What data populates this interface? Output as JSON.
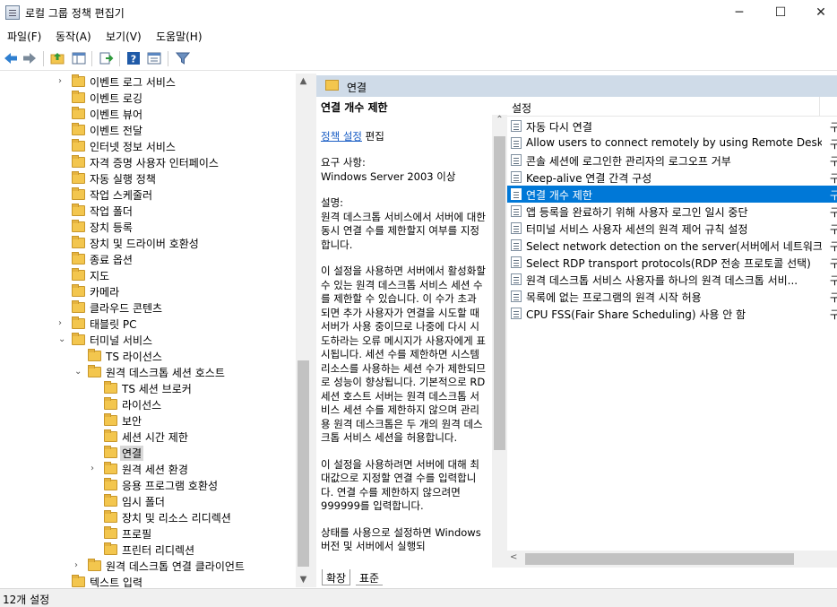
{
  "window": {
    "title": "로컬 그룹 정책 편집기",
    "minimize": "─",
    "maximize": "☐",
    "close": "✕"
  },
  "menu": [
    "파일(F)",
    "동작(A)",
    "보기(V)",
    "도움말(H)"
  ],
  "tree": [
    {
      "label": "이벤트 로그 서비스",
      "level": 0,
      "exp": "›"
    },
    {
      "label": "이벤트 로깅",
      "level": 0,
      "exp": ""
    },
    {
      "label": "이벤트 뷰어",
      "level": 0,
      "exp": ""
    },
    {
      "label": "이벤트 전달",
      "level": 0,
      "exp": ""
    },
    {
      "label": "인터넷 정보 서비스",
      "level": 0,
      "exp": ""
    },
    {
      "label": "자격 증명 사용자 인터페이스",
      "level": 0,
      "exp": ""
    },
    {
      "label": "자동 실행 정책",
      "level": 0,
      "exp": ""
    },
    {
      "label": "작업 스케줄러",
      "level": 0,
      "exp": ""
    },
    {
      "label": "작업 폴더",
      "level": 0,
      "exp": ""
    },
    {
      "label": "장치 등록",
      "level": 0,
      "exp": ""
    },
    {
      "label": "장치 및 드라이버 호환성",
      "level": 0,
      "exp": ""
    },
    {
      "label": "종료 옵션",
      "level": 0,
      "exp": ""
    },
    {
      "label": "지도",
      "level": 0,
      "exp": ""
    },
    {
      "label": "카메라",
      "level": 0,
      "exp": ""
    },
    {
      "label": "클라우드 콘텐츠",
      "level": 0,
      "exp": ""
    },
    {
      "label": "태블릿 PC",
      "level": 0,
      "exp": "›"
    },
    {
      "label": "터미널 서비스",
      "level": 0,
      "exp": "⌄"
    },
    {
      "label": "TS 라이선스",
      "level": 1,
      "exp": ""
    },
    {
      "label": "원격 데스크톱 세션 호스트",
      "level": 1,
      "exp": "⌄"
    },
    {
      "label": "TS 세션 브로커",
      "level": 2,
      "exp": ""
    },
    {
      "label": "라이선스",
      "level": 2,
      "exp": ""
    },
    {
      "label": "보안",
      "level": 2,
      "exp": ""
    },
    {
      "label": "세션 시간 제한",
      "level": 2,
      "exp": ""
    },
    {
      "label": "연결",
      "level": 2,
      "exp": "",
      "selected": true
    },
    {
      "label": "원격 세션 환경",
      "level": 2,
      "exp": "›"
    },
    {
      "label": "응용 프로그램 호환성",
      "level": 2,
      "exp": ""
    },
    {
      "label": "임시 폴더",
      "level": 2,
      "exp": ""
    },
    {
      "label": "장치 및 리소스 리디렉션",
      "level": 2,
      "exp": ""
    },
    {
      "label": "프로필",
      "level": 2,
      "exp": ""
    },
    {
      "label": "프린터 리디렉션",
      "level": 2,
      "exp": ""
    },
    {
      "label": "원격 데스크톱 연결 클라이언트",
      "level": 1,
      "exp": "›"
    },
    {
      "label": "텍스트 입력",
      "level": 0,
      "exp": ""
    }
  ],
  "right_header": "연결",
  "description": {
    "title": "연결 개수 제한",
    "edit_link": "정책 설정",
    "edit_suffix": " 편집",
    "req_label": "요구 사항:",
    "req_value": "Windows Server 2003 이상",
    "desc_label": "설명:",
    "p1": "원격 데스크톱 서비스에서 서버에 대한 동시 연결 수를 제한할지 여부를 지정합니다.",
    "p2": "이 설정을 사용하면 서버에서 활성화할 수 있는 원격 데스크톱 서비스 세션 수를 제한할 수 있습니다. 이 수가 초과되면 추가 사용자가 연결을 시도할 때 서버가 사용 중이므로 나중에 다시 시도하라는 오류 메시지가 사용자에게 표시됩니다. 세션 수를 제한하면 시스템 리소스를 사용하는 세션 수가 제한되므로 성능이 향상됩니다. 기본적으로 RD 세션 호스트 서버는 원격 데스크톱 서비스 세션 수를 제한하지 않으며 관리용 원격 데스크톱은 두 개의 원격 데스크톱 서비스 세션을 허용합니다.",
    "p3": "이 설정을 사용하려면 서버에 대해 최대값으로 지정할 연결 수를 입력합니다. 연결 수를 제한하지 않으려면 999999를 입력합니다.",
    "p4": "상태를 사용으로 설정하면 Windows 버전 및 서버에서 실행되"
  },
  "list_header": "설정",
  "list": [
    {
      "label": "자동 다시 연결",
      "state": "구"
    },
    {
      "label": "Allow users to connect remotely by using Remote Desktop...",
      "state": "구"
    },
    {
      "label": "콘솔 세션에 로그인한 관리자의 로그오프 거부",
      "state": "구"
    },
    {
      "label": "Keep-alive 연결 간격 구성",
      "state": "구"
    },
    {
      "label": "연결 개수 제한",
      "state": "구",
      "selected": true
    },
    {
      "label": "앱 등록을 완료하기 위해 사용자 로그인 일시 중단",
      "state": "구"
    },
    {
      "label": "터미널 서비스 사용자 세션의 원격 제어 규칙 설정",
      "state": "구"
    },
    {
      "label": "Select network detection on the server(서버에서 네트워크 ...",
      "state": "구"
    },
    {
      "label": "Select RDP transport protocols(RDP 전송 프로토콜 선택)",
      "state": "구"
    },
    {
      "label": "원격 데스크톱 서비스 사용자를 하나의 원격 데스크톱 서비...",
      "state": "구"
    },
    {
      "label": "목록에 없는 프로그램의 원격 시작 허용",
      "state": "구"
    },
    {
      "label": "CPU FSS(Fair Share Scheduling) 사용 안 함",
      "state": "구"
    }
  ],
  "tabs": [
    "확장",
    "표준"
  ],
  "status": "12개 설정"
}
